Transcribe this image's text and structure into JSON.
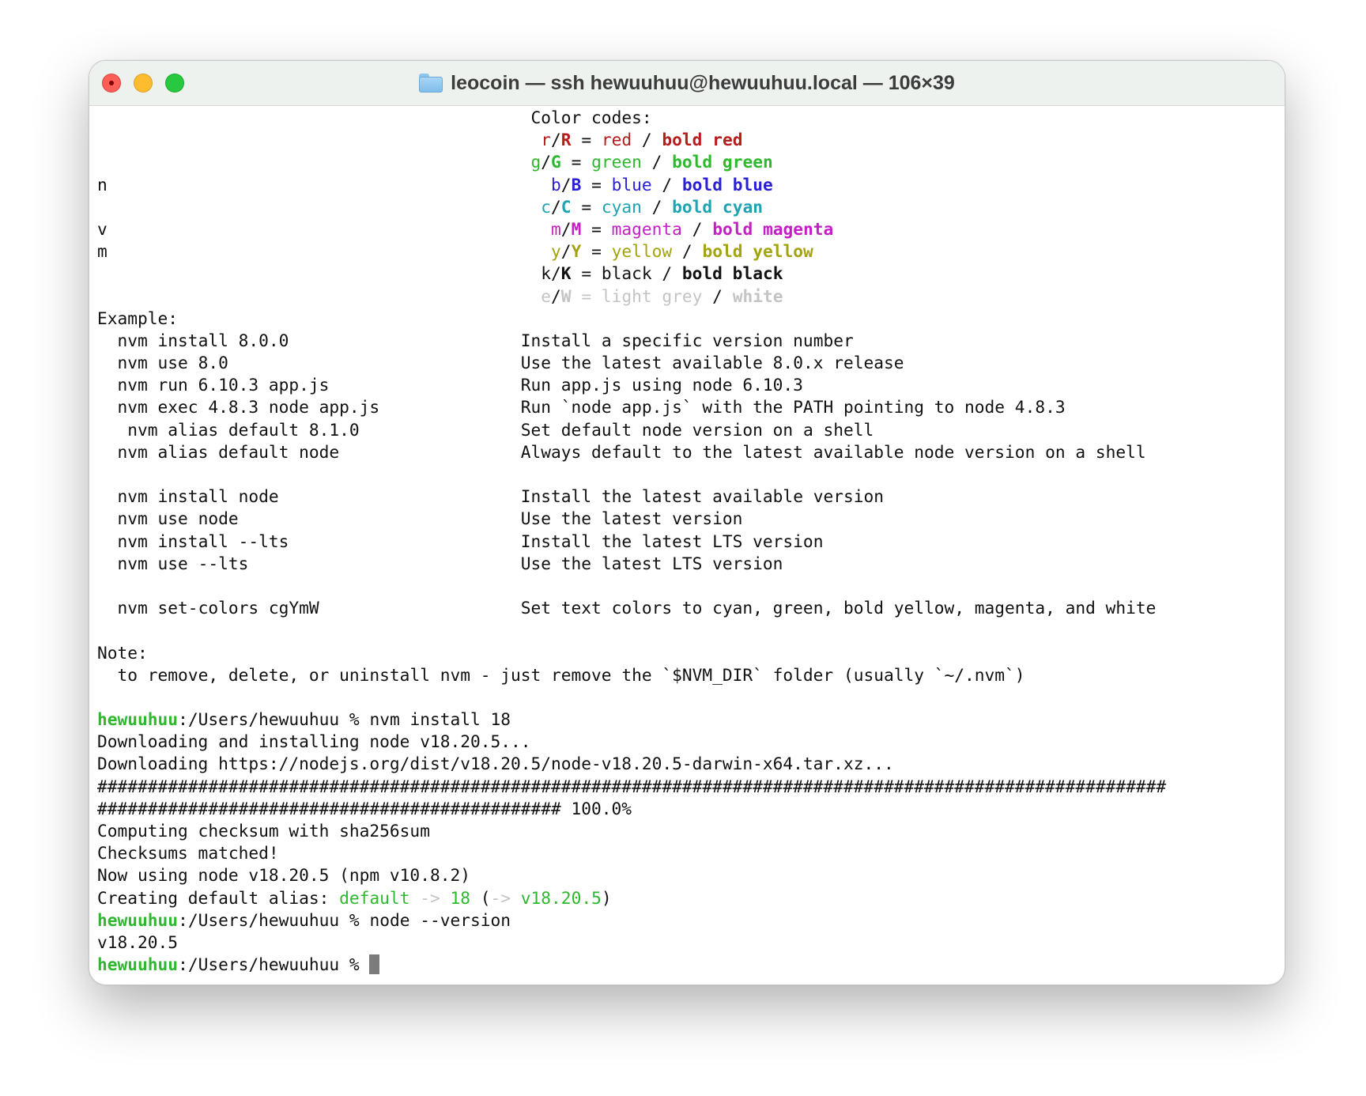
{
  "window": {
    "title": "leocoin — ssh hewuuhuu@hewuuhuu.local — 106×39"
  },
  "terminal": {
    "color_codes": {
      "header": "Color codes:",
      "rows": [
        {
          "lower": "r",
          "upper": "R",
          "name": "red",
          "bold_name": "bold red",
          "color": "#b71c1c"
        },
        {
          "lower": "g",
          "upper": "G",
          "name": "green",
          "bold_name": "bold green",
          "color": "#2eb82e"
        },
        {
          "lower": "b",
          "upper": "B",
          "name": "blue",
          "bold_name": "bold blue",
          "color": "#2b1fd6"
        },
        {
          "lower": "c",
          "upper": "C",
          "name": "cyan",
          "bold_name": "bold cyan",
          "color": "#1ea3b0"
        },
        {
          "lower": "m",
          "upper": "M",
          "name": "magenta",
          "bold_name": "bold magenta",
          "color": "#c41fc4"
        },
        {
          "lower": "y",
          "upper": "Y",
          "name": "yellow",
          "bold_name": "bold yellow",
          "color": "#a3a310"
        },
        {
          "lower": "k",
          "upper": "K",
          "name": "black",
          "bold_name": "bold black",
          "color": "#111111"
        },
        {
          "lower": "e",
          "upper": "W",
          "name": "light grey",
          "bold_name": "white",
          "color": "#c4c4c4"
        }
      ],
      "left_letters": {
        "n": "n",
        "v": "v",
        "m": "m"
      }
    },
    "example": {
      "header": "Example:",
      "rows": [
        {
          "cmd": "nvm install 8.0.0",
          "desc": "Install a specific version number"
        },
        {
          "cmd": "nvm use 8.0",
          "desc": "Use the latest available 8.0.x release"
        },
        {
          "cmd": "nvm run 6.10.3 app.js",
          "desc": "Run app.js using node 6.10.3"
        },
        {
          "cmd": "nvm exec 4.8.3 node app.js",
          "desc": "Run `node app.js` with the PATH pointing to node 4.8.3"
        },
        {
          "cmd": "nvm alias default 8.1.0",
          "desc": "Set default node version on a shell"
        },
        {
          "cmd": "nvm alias default node",
          "desc": "Always default to the latest available node version on a shell"
        },
        {
          "cmd": "nvm install node",
          "desc": "Install the latest available version"
        },
        {
          "cmd": "nvm use node",
          "desc": "Use the latest version"
        },
        {
          "cmd": "nvm install --lts",
          "desc": "Install the latest LTS version"
        },
        {
          "cmd": "nvm use --lts",
          "desc": "Use the latest LTS version"
        },
        {
          "cmd": "nvm set-colors cgYmW",
          "desc": "Set text colors to cyan, green, bold yellow, magenta, and white"
        }
      ]
    },
    "note": {
      "header": "Note:",
      "text": "to remove, delete, or uninstall nvm - just remove the `$NVM_DIR` folder (usually `~/.nvm`)"
    },
    "prompt": {
      "user": "hewuuhuu",
      "path": ":/Users/hewuuhuu % "
    },
    "session": {
      "cmd1": "nvm install 18",
      "downloading_installing": "Downloading and installing node v18.20.5...",
      "downloading_url": "Downloading https://nodejs.org/dist/v18.20.5/node-v18.20.5-darwin-x64.tar.xz...",
      "hash_line_1": "##########################################################################################################",
      "hash_line_2": "############################################## 100.0%",
      "checksum": "Computing checksum with sha256sum",
      "matched": "Checksums matched!",
      "now_using": "Now using node v18.20.5 (npm v10.8.2)",
      "alias_prefix": "Creating default alias: ",
      "alias_default": "default",
      "alias_arrow": " -> ",
      "alias_18": "18",
      "alias_open": " (",
      "alias_arrow2": "->",
      "alias_version": " v18.20.5",
      "alias_close": ")",
      "cmd2": "node --version",
      "version_output": "v18.20.5"
    },
    "colors": {
      "prompt_user": "#2eb82e",
      "alias_green": "#2eb82e",
      "cursor": "#7b7b7b"
    }
  }
}
